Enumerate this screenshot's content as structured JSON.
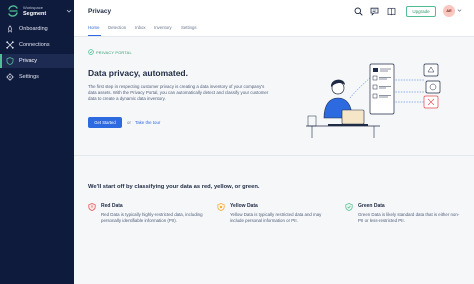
{
  "workspace": {
    "label": "Workspace",
    "name": "Segment"
  },
  "sidebar": {
    "items": [
      {
        "label": "Onboarding",
        "icon": "rocket-icon",
        "active": false
      },
      {
        "label": "Connections",
        "icon": "connections-icon",
        "active": false
      },
      {
        "label": "Privacy",
        "icon": "shield-icon",
        "active": true
      },
      {
        "label": "Settings",
        "icon": "gear-icon",
        "active": false
      }
    ]
  },
  "header": {
    "title": "Privacy",
    "tabs": [
      {
        "label": "Home",
        "active": true
      },
      {
        "label": "Detection",
        "active": false
      },
      {
        "label": "Inbox",
        "active": false
      },
      {
        "label": "Inventory",
        "active": false
      },
      {
        "label": "Settings",
        "active": false
      }
    ],
    "upgrade_label": "Upgrade",
    "avatar_initials": "AE"
  },
  "hero": {
    "badge": "PRIVACY PORTAL",
    "title": "Data privacy, automated.",
    "body": "The first step in respecting customer privacy is creating a data inventory of your company's data assets. With the Privacy Portal, you can automatically detect and classify your customer data to create a dynamic data inventory.",
    "cta_label": "Get Started",
    "or_text": "or",
    "tour_label": "Take the tour"
  },
  "classify": {
    "title": "We'll start off by classifying your data as red, yellow, or green.",
    "cards": [
      {
        "title": "Red Data",
        "desc": "Red Data is typically highly-restricted data, including personally identifiable information (PII).",
        "color": "#e5484d",
        "icon": "red-shield-icon"
      },
      {
        "title": "Yellow Data",
        "desc": "Yellow Data is typically restricted data and may include personal information or PII.",
        "color": "#f5a623",
        "icon": "yellow-shield-icon"
      },
      {
        "title": "Green Data",
        "desc": "Green Data is likely standard data that is either non-PII or less-restricted PII.",
        "color": "#52bd94",
        "icon": "green-shield-icon"
      }
    ]
  },
  "colors": {
    "sidebar_bg": "#0f1b3d",
    "accent_blue": "#2d6ae0",
    "accent_green": "#52bd94"
  }
}
